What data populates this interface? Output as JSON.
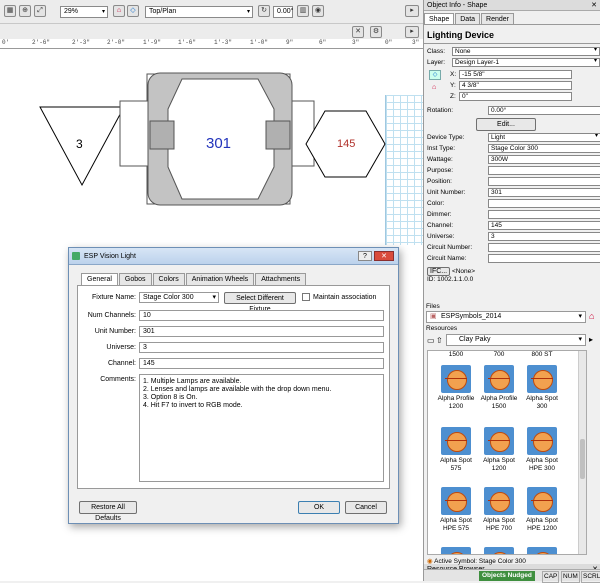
{
  "toolbar": {
    "zoom": "29%",
    "view": "Top/Plan",
    "rotation": "0.00°"
  },
  "ruler": [
    "0'",
    "2'-6\"",
    "2'-3\"",
    "2'-0\"",
    "1'-9\"",
    "1'-6\"",
    "1'-3\"",
    "1'-0\"",
    "9\"",
    "6\"",
    "3\"",
    "0\"",
    "3\""
  ],
  "canvas": {
    "left_label": "3",
    "center_label": "301",
    "right_label": "145"
  },
  "obj_info": {
    "title": "Object Info - Shape",
    "tabs": [
      "Shape",
      "Data",
      "Render"
    ],
    "object": "Lighting Device",
    "class": "None",
    "layer": "Design Layer-1",
    "x": "-15 5/8\"",
    "y": "4 3/8\"",
    "z": "0\"",
    "rotation": "0.00°",
    "edit": "Edit...",
    "device_type": "Light",
    "inst_type": "Stage Color 300",
    "wattage": "300W",
    "unit_number": "301",
    "channel": "145",
    "universe": "3",
    "labels": {
      "class": "Class:",
      "layer": "Layer:",
      "x": "X:",
      "y": "Y:",
      "z": "Z:",
      "rotation": "Rotation:",
      "device_type": "Device Type:",
      "inst_type": "Inst Type:",
      "wattage": "Wattage:",
      "purpose": "Purpose:",
      "position": "Position:",
      "unit_number": "Unit Number:",
      "color": "Color:",
      "dimmer": "Dimmer:",
      "channel": "Channel:",
      "universe": "Universe:",
      "circuit_number": "Circuit Number:",
      "circuit_name": "Circuit Name:"
    },
    "ifc": "IFC...",
    "ifc_value": "<None>",
    "id_label": "ID:",
    "id_value": "1002.1.1.0.0"
  },
  "resource": {
    "title": "Resource Browser",
    "files_label": "Files",
    "file": "ESPSymbols_2014",
    "resources_label": "Resources",
    "folder": "Clay Paky",
    "top_row": [
      "1500",
      "700",
      "800 ST"
    ],
    "items": [
      [
        "Alpha Profile",
        "1200"
      ],
      [
        "Alpha Profile",
        "1500"
      ],
      [
        "Alpha Spot",
        "300"
      ],
      [
        "Alpha Spot",
        "575"
      ],
      [
        "Alpha Spot",
        "1200"
      ],
      [
        "Alpha Spot",
        "HPE 300"
      ],
      [
        "Alpha Spot",
        "HPE 575"
      ],
      [
        "Alpha Spot",
        "HPE 700"
      ],
      [
        "Alpha Spot",
        "HPE 1200"
      ]
    ],
    "active": "Active Symbol: Stage Color 300"
  },
  "status": {
    "nudged": "Objects Nudged",
    "cap": "CAP",
    "num": "NUM",
    "scrl": "SCRL"
  },
  "dialog": {
    "title": "ESP Vision Light",
    "tabs": [
      "General",
      "Gobos",
      "Colors",
      "Animation Wheels",
      "Attachments"
    ],
    "fixture_label": "Fixture Name:",
    "fixture": "Stage Color 300",
    "select_btn": "Select Different Fixture",
    "maintain": "Maintain association",
    "num_channels_label": "Num Channels:",
    "num_channels": "10",
    "unit_number_label": "Unit Number:",
    "unit_number": "301",
    "universe_label": "Universe:",
    "universe": "3",
    "channel_label": "Channel:",
    "channel": "145",
    "comments_label": "Comments:",
    "comments": [
      "1.  Multiple Lamps are available.",
      "2.  Lenses and lamps are available with the drop down menu.",
      "3.  Option 8 is On.",
      "4.  Hit F7 to invert to RGB mode."
    ],
    "restore": "Restore All Defaults",
    "ok": "OK",
    "cancel": "Cancel"
  }
}
